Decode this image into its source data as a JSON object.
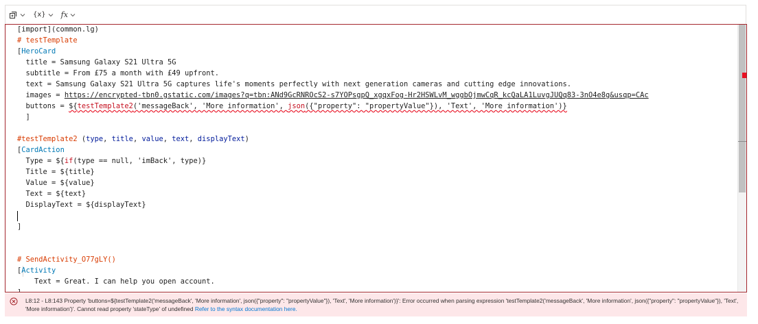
{
  "toolbar": {
    "items": [
      {
        "icon": "insert-template-icon",
        "label": ""
      },
      {
        "icon": "variable-icon",
        "label": "{x}"
      },
      {
        "icon": "function-icon",
        "label": "fx"
      }
    ]
  },
  "editor": {
    "lines": [
      [
        {
          "t": "[import](common.lg)",
          "c": ""
        }
      ],
      [
        {
          "t": "# testTemplate",
          "c": "comment"
        }
      ],
      [
        {
          "t": "[",
          "c": ""
        },
        {
          "t": "HeroCard",
          "c": "struct"
        }
      ],
      [
        {
          "t": "  title = Samsung Galaxy S21 Ultra 5G",
          "c": ""
        }
      ],
      [
        {
          "t": "  subtitle = From £75 a month with £49 upfront.",
          "c": ""
        }
      ],
      [
        {
          "t": "  text = Samsung Galaxy S21 Ultra 5G captures life's moments perfectly with next generation cameras and cutting edge innovations.",
          "c": ""
        }
      ],
      [
        {
          "t": "  images = ",
          "c": ""
        },
        {
          "t": "https://encrypted-tbn0.gstatic.com/images?q=tbn:ANd9GcRNROcS2-s7YOPsgpQ_xgqxFog-Hr2HSWLvM_wggbOjmwCqR_kcQaLA1LuvgJUQq83-3nO4e8g&usqp=CAc",
          "c": "link"
        }
      ],
      [
        {
          "t": "  buttons = ",
          "c": ""
        },
        {
          "t": "${",
          "c": "err"
        },
        {
          "t": "testTemplate2",
          "c": "err func"
        },
        {
          "t": "('messageBack', 'More information', ",
          "c": "err"
        },
        {
          "t": "json",
          "c": "err func"
        },
        {
          "t": "({\"property\": \"propertyValue\"}), 'Text', 'More information')}",
          "c": "err"
        }
      ],
      [
        {
          "t": "  ]",
          "c": ""
        }
      ],
      [
        {
          "t": "",
          "c": ""
        }
      ],
      [
        {
          "t": "#testTemplate2",
          "c": "comment"
        },
        {
          "t": " (",
          "c": ""
        },
        {
          "t": "type",
          "c": "param"
        },
        {
          "t": ", ",
          "c": ""
        },
        {
          "t": "title",
          "c": "param"
        },
        {
          "t": ", ",
          "c": ""
        },
        {
          "t": "value",
          "c": "param"
        },
        {
          "t": ", ",
          "c": ""
        },
        {
          "t": "text",
          "c": "param"
        },
        {
          "t": ", ",
          "c": ""
        },
        {
          "t": "displayText",
          "c": "param"
        },
        {
          "t": ")",
          "c": ""
        }
      ],
      [
        {
          "t": "[",
          "c": ""
        },
        {
          "t": "CardAction",
          "c": "struct"
        }
      ],
      [
        {
          "t": "  Type = ${",
          "c": ""
        },
        {
          "t": "if",
          "c": "func"
        },
        {
          "t": "(type == null, 'imBack', type)}",
          "c": ""
        }
      ],
      [
        {
          "t": "  Title = ${title}",
          "c": ""
        }
      ],
      [
        {
          "t": "  Value = ${value}",
          "c": ""
        }
      ],
      [
        {
          "t": "  Text = ${text}",
          "c": ""
        }
      ],
      [
        {
          "t": "  DisplayText = ${displayText}",
          "c": ""
        }
      ],
      [
        {
          "t": "",
          "c": ""
        }
      ],
      [
        {
          "t": "]",
          "c": ""
        }
      ],
      [
        {
          "t": "",
          "c": ""
        }
      ],
      [
        {
          "t": "",
          "c": ""
        }
      ],
      [
        {
          "t": "# SendActivity_O77gLY()",
          "c": "comment"
        }
      ],
      [
        {
          "t": "[",
          "c": ""
        },
        {
          "t": "Activity",
          "c": "struct"
        }
      ],
      [
        {
          "t": "    Text = Great. I can help you open account.",
          "c": ""
        }
      ],
      [
        {
          "t": "]",
          "c": ""
        }
      ]
    ]
  },
  "error": {
    "message": "L8:12 - L8:143 Property 'buttons=${testTemplate2('messageBack', 'More information', json({\"property\": \"propertyValue\"}), 'Text', 'More information')}': Error occurred when parsing expression 'testTemplate2('messageBack', 'More information', json({\"property\": \"propertyValue\"}), 'Text', 'More information')'. Cannot read property 'stateType' of undefined",
    "link": "Refer to the syntax documentation here.",
    "color": "#a4262c"
  }
}
